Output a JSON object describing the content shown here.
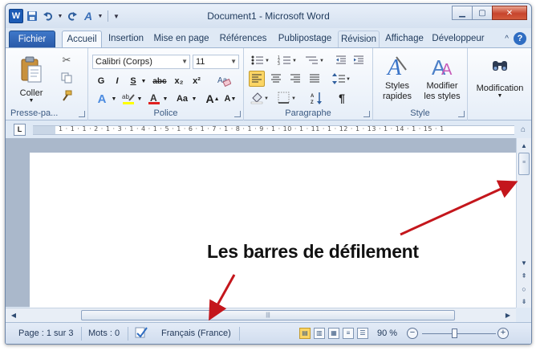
{
  "window": {
    "title": "Document1 - Microsoft Word"
  },
  "qat": {
    "logo": "W"
  },
  "tabs": [
    {
      "label": "Fichier"
    },
    {
      "label": "Accueil"
    },
    {
      "label": "Insertion"
    },
    {
      "label": "Mise en page"
    },
    {
      "label": "Références"
    },
    {
      "label": "Publipostage"
    },
    {
      "label": "Révision"
    },
    {
      "label": "Affichage"
    },
    {
      "label": "Développeur"
    }
  ],
  "ribbon": {
    "clipboard": {
      "label": "Presse-pa...",
      "paste_label": "Coller"
    },
    "font": {
      "label": "Police",
      "font_name": "Calibri (Corps)",
      "font_size": "11",
      "bold": "G",
      "italic": "I",
      "underline": "S",
      "strike": "abc",
      "subscript": "x₂",
      "superscript": "x²",
      "case": "Aa",
      "grow": "A",
      "shrink": "A"
    },
    "paragraph": {
      "label": "Paragraphe",
      "pilcrow": "¶"
    },
    "style": {
      "label": "Style",
      "quick_styles": "Styles\nrapides",
      "change_styles": "Modifier\nles styles"
    },
    "editing": {
      "label": "Modification"
    }
  },
  "ruler": {
    "marker": "L",
    "numbers": "1 · 1 · 1 · 2 · 1 · 3 · 1 · 4 · 1 · 5 · 1 · 6 · 1 · 7 · 1 · 8 · 1 · 9 · 1 · 10 · 1 · 11 · 1 · 12 · 1 · 13 · 1 · 14 · 1 · 15 · 1"
  },
  "document": {
    "caption": "Les barres de défilement"
  },
  "statusbar": {
    "page": "Page : 1 sur 3",
    "words": "Mots : 0",
    "language": "Français (France)",
    "zoom": "90 %",
    "zoom_level_percent": 90
  }
}
